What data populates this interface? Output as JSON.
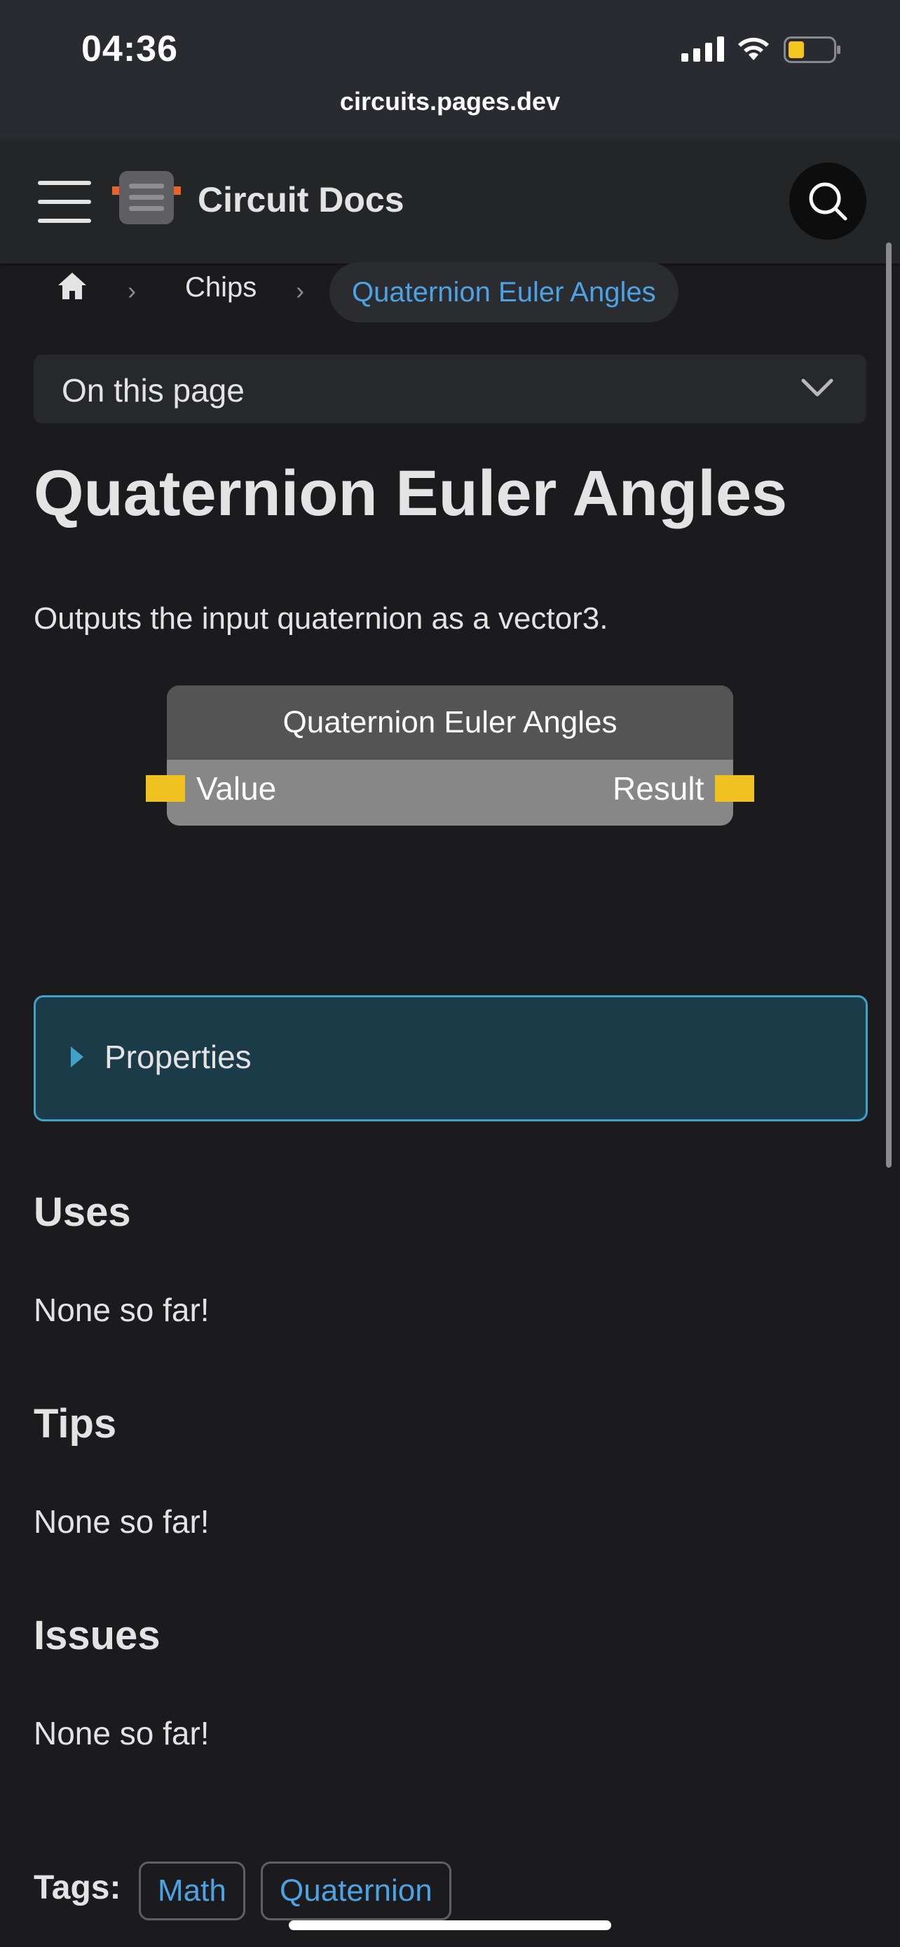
{
  "status_bar": {
    "time": "04:36",
    "url": "circuits.pages.dev",
    "battery_color": "#f4c51d"
  },
  "navbar": {
    "brand": "Circuit Docs",
    "menu_icon": "hamburger-icon",
    "search_icon": "search-icon"
  },
  "breadcrumb": {
    "home_icon": "home-icon",
    "items": [
      "Chips",
      "Quaternion Euler Angles"
    ]
  },
  "toc": {
    "label": "On this page"
  },
  "page": {
    "title": "Quaternion Euler Angles",
    "description": "Outputs the input quaternion as a vector3."
  },
  "chip": {
    "name": "Quaternion Euler Angles",
    "input_port": "Value",
    "output_port": "Result",
    "port_color": "#f0c21f"
  },
  "details": {
    "label": "Properties"
  },
  "sections": [
    {
      "heading": "Uses",
      "text": "None so far!"
    },
    {
      "heading": "Tips",
      "text": "None so far!"
    },
    {
      "heading": "Issues",
      "text": "None so far!"
    }
  ],
  "tags": {
    "label": "Tags:",
    "items": [
      "Math",
      "Quaternion"
    ]
  },
  "colors": {
    "link": "#4ba3e3",
    "background": "#1b1b1d",
    "details_border": "#3fa2c8"
  }
}
